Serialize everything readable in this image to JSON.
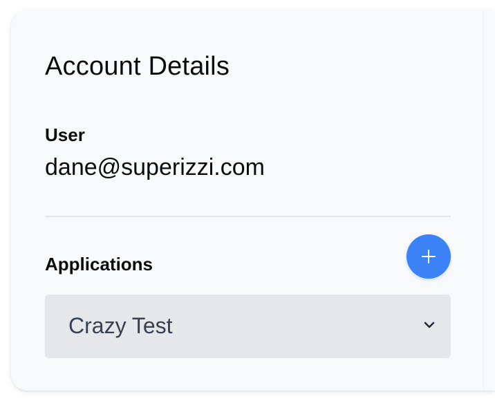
{
  "panel": {
    "title": "Account Details"
  },
  "user": {
    "label": "User",
    "value": "dane@superizzi.com"
  },
  "applications": {
    "label": "Applications",
    "add_button_icon": "plus-icon",
    "selected": "Crazy Test",
    "dropdown_icon": "chevron-down-icon"
  },
  "colors": {
    "accent": "#3b82f6",
    "card_background": "#f8f9fb",
    "select_background": "#e5e7eb",
    "divider": "#e4e6ea"
  }
}
